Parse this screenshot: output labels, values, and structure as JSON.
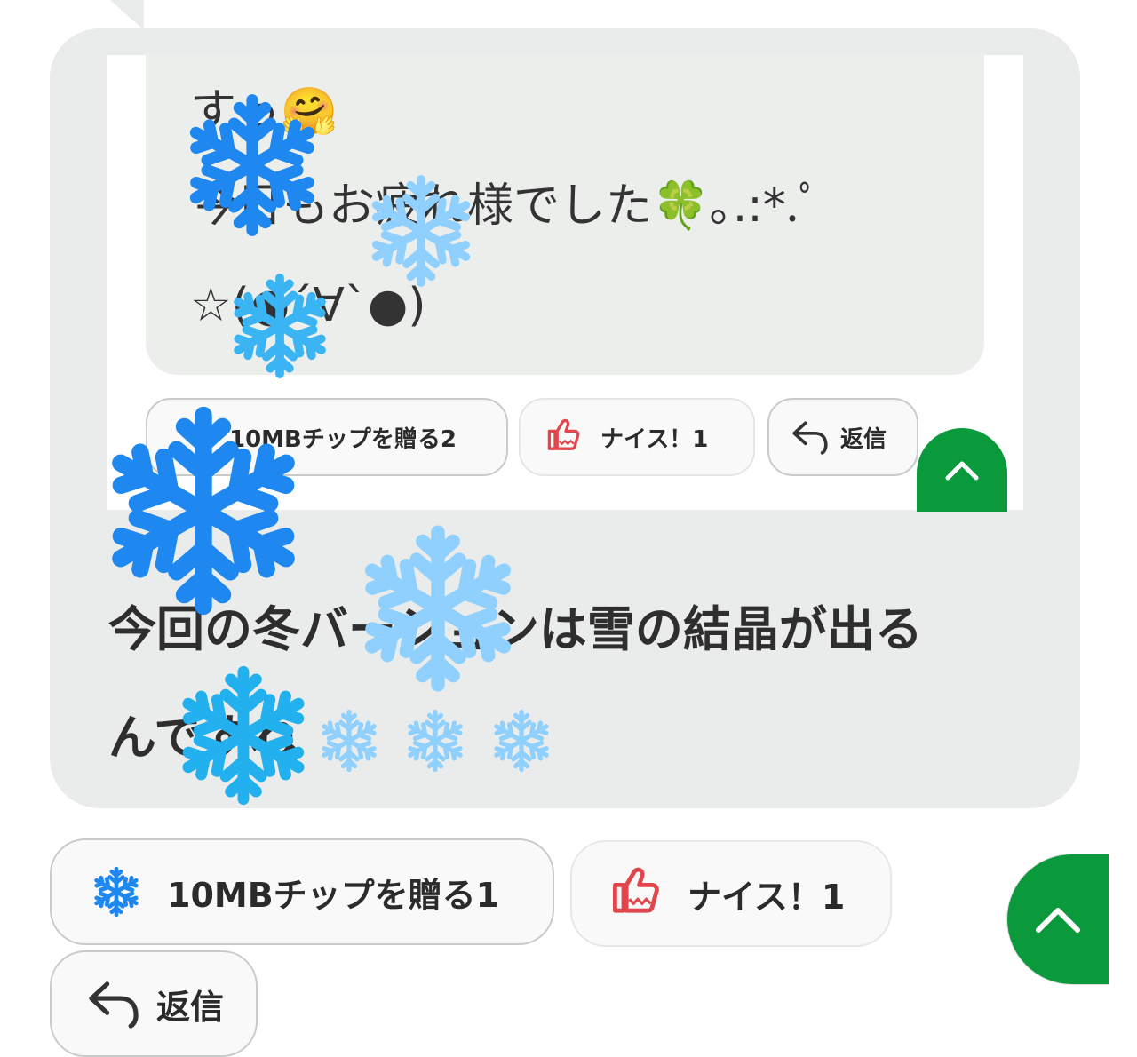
{
  "quoted_message": {
    "lines": [
      "すっ🤗",
      "今日もお疲れ様でした🍀｡.:*.ﾟ",
      "☆(●´∀`●)"
    ]
  },
  "quoted_reactions": {
    "tip_label": "10MBチップを贈る2",
    "nice_label": "ナイス！1",
    "reply_label": "返信"
  },
  "message": {
    "line1": "今回の冬バージョンは雪の結晶が出る",
    "line2": "んですね"
  },
  "reactions": {
    "tip_label": "10MBチップを贈る1",
    "nice_label": "ナイス！1",
    "reply_label": "返信"
  },
  "colors": {
    "bubble": "#e9ecea",
    "fab_green": "#0a9a3c",
    "thumb_red": "#e0464b",
    "snow_blue": "#1e88f0",
    "snow_light": "#8fd0ff"
  },
  "icons": [
    "snowflake-icon",
    "thumbs-up-icon",
    "reply-arrow-icon",
    "chevron-up-icon"
  ]
}
